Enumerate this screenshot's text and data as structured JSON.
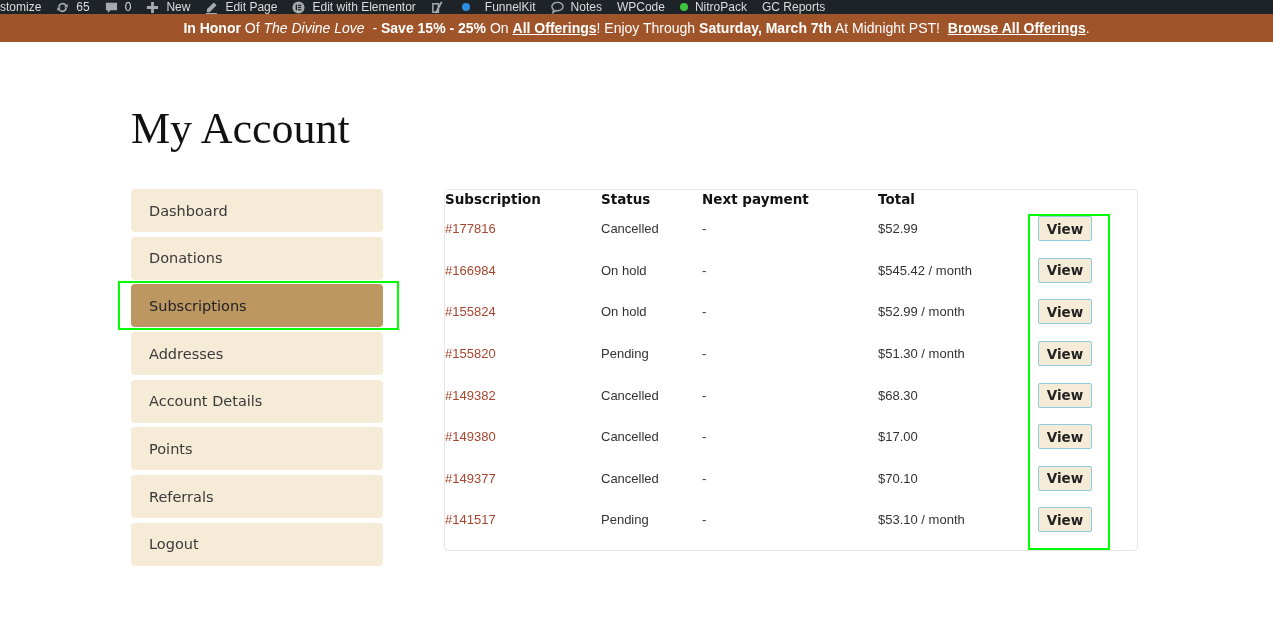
{
  "admin_bar": {
    "items": [
      {
        "kind": "plain",
        "label": "stomize"
      },
      {
        "kind": "updates",
        "label": "65"
      },
      {
        "kind": "comments",
        "label": "0"
      },
      {
        "kind": "new",
        "label": "New"
      },
      {
        "kind": "edit",
        "label": "Edit Page"
      },
      {
        "kind": "elementor",
        "label": "Edit with Elementor"
      },
      {
        "kind": "seo",
        "color": "#2c8fe0"
      },
      {
        "kind": "plain",
        "label": "FunnelKit"
      },
      {
        "kind": "notes",
        "label": "Notes"
      },
      {
        "kind": "plain",
        "label": "WPCode"
      },
      {
        "kind": "status",
        "color": "#3fc43f",
        "label": "NitroPack"
      },
      {
        "kind": "plain",
        "label": "GC Reports"
      }
    ]
  },
  "banner": {
    "parts": [
      {
        "kind": "text",
        "text": "**In Honor** Of *The Divine Love*  - **Save 15% - 25%** On "
      },
      {
        "kind": "link",
        "text": "All Offerings"
      },
      {
        "kind": "text",
        "text": "! Enjoy Through **Saturday, March 7th** At Midnight PST!  "
      },
      {
        "kind": "link",
        "text": "Browse All Offerings"
      },
      {
        "kind": "text",
        "text": "."
      }
    ]
  },
  "page_title": "My Account",
  "sidebar": {
    "items": [
      {
        "label": "Dashboard",
        "selected": false,
        "highlighted": false
      },
      {
        "label": "Donations",
        "selected": false,
        "highlighted": false
      },
      {
        "label": "Subscriptions",
        "selected": true,
        "highlighted": true
      },
      {
        "label": "Addresses",
        "selected": false,
        "highlighted": false
      },
      {
        "label": "Account Details",
        "selected": false,
        "highlighted": false
      },
      {
        "label": "Points",
        "selected": false,
        "highlighted": false
      },
      {
        "label": "Referrals",
        "selected": false,
        "highlighted": false
      },
      {
        "label": "Logout",
        "selected": false,
        "highlighted": false
      }
    ]
  },
  "table": {
    "columns": [
      "Subscription",
      "Status",
      "Next payment",
      "Total"
    ],
    "actions_highlighted": true,
    "rows": [
      {
        "subscription": "#177816",
        "status": "Cancelled",
        "next_payment": "-",
        "total": "$52.99",
        "action": "View"
      },
      {
        "subscription": "#166984",
        "status": "On hold",
        "next_payment": "-",
        "total": "$545.42 / month",
        "action": "View"
      },
      {
        "subscription": "#155824",
        "status": "On hold",
        "next_payment": "-",
        "total": "$52.99 / month",
        "action": "View"
      },
      {
        "subscription": "#155820",
        "status": "Pending",
        "next_payment": "-",
        "total": "$51.30 / month",
        "action": "View"
      },
      {
        "subscription": "#149382",
        "status": "Cancelled",
        "next_payment": "-",
        "total": "$68.30",
        "action": "View"
      },
      {
        "subscription": "#149380",
        "status": "Cancelled",
        "next_payment": "-",
        "total": "$17.00",
        "action": "View"
      },
      {
        "subscription": "#149377",
        "status": "Cancelled",
        "next_payment": "-",
        "total": "$70.10",
        "action": "View"
      },
      {
        "subscription": "#141517",
        "status": "Pending",
        "next_payment": "-",
        "total": "$53.10 / month",
        "action": "View"
      }
    ]
  }
}
